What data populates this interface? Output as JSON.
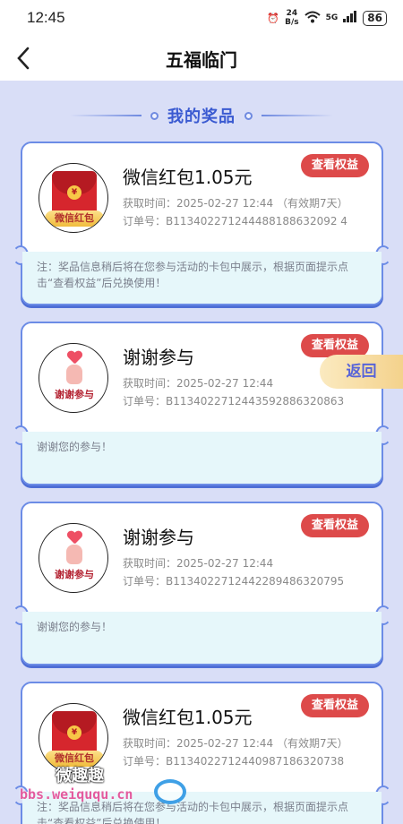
{
  "status": {
    "time": "12:45",
    "net_speed_top": "24",
    "net_speed_bottom": "B/s",
    "network": "5G",
    "battery": "86"
  },
  "nav": {
    "title": "五福临门"
  },
  "section": {
    "title": "我的奖品"
  },
  "common": {
    "view_label": "查看权益",
    "time_prefix": "获取时间：",
    "order_prefix": "订单号："
  },
  "prizes": [
    {
      "name": "微信红包1.05元",
      "time": "2025-02-27 12:44  （有效期7天）",
      "order": "B113402271244488188632092 4",
      "note": "注：奖品信息稍后将在您参与活动的卡包中展示，根据页面提示点击“查看权益”后兑换使用！",
      "icon_label": "微信红包"
    },
    {
      "name": "谢谢参与",
      "time": "2025-02-27 12:44",
      "order": "B1134022712443592886320863",
      "note": "谢谢您的参与！",
      "icon_label": "谢谢参与"
    },
    {
      "name": "谢谢参与",
      "time": "2025-02-27 12:44",
      "order": "B1134022712442289486320795",
      "note": "谢谢您的参与！",
      "icon_label": "谢谢参与"
    },
    {
      "name": "微信红包1.05元",
      "time": "2025-02-27 12:44  （有效期7天）",
      "order": "B1134022712440987186320738",
      "note": "注：奖品信息稍后将在您参与活动的卡包中展示，根据页面提示点击“查看权益”后兑换使用！",
      "icon_label": "微信红包"
    }
  ],
  "float": {
    "back_label": "返回"
  },
  "watermark": {
    "title": "微趣趣",
    "url": "bbs.weiququ.cn"
  }
}
